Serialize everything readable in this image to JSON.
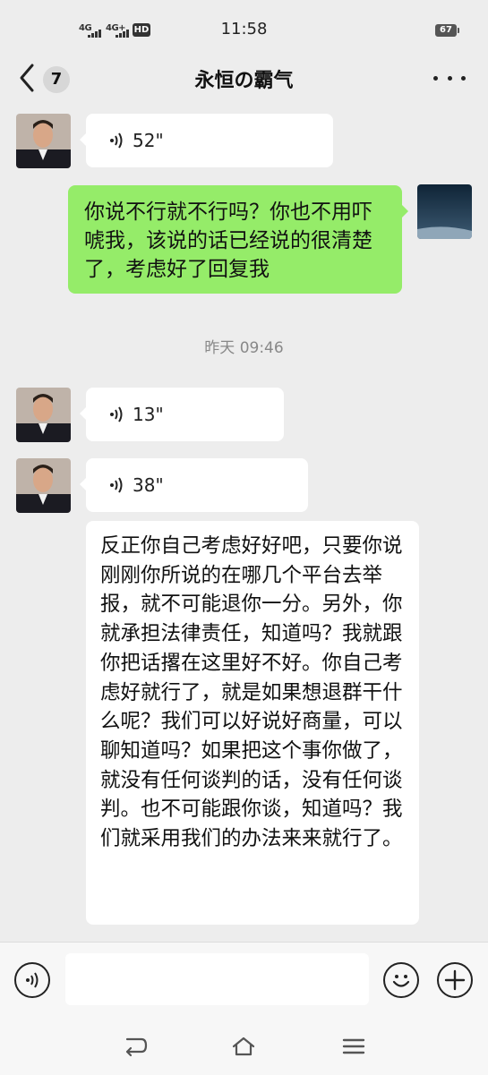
{
  "status_bar": {
    "net1": "4G",
    "net2": "4G+",
    "hd": "HD",
    "time": "11:58",
    "battery": "67"
  },
  "header": {
    "unread_count": "7",
    "title": "永恒の霸气"
  },
  "timestamp": "昨天 09:46",
  "messages": [
    {
      "duration": "52\""
    },
    {
      "text": "你说不行就不行吗？你也不用吓唬我，该说的话已经说的很清楚了，考虑好了回复我"
    },
    {
      "duration": "13\""
    },
    {
      "duration": "38\""
    },
    {
      "text": "反正你自己考虑好好吧，只要你说刚刚你所说的在哪几个平台去举报，就不可能退你一分。另外，你就承担法律责任，知道吗？我就跟你把话撂在这里好不好。你自己考虑好就行了，就是如果想退群干什么呢？我们可以好说好商量，可以聊知道吗？如果把这个事你做了，就没有任何谈判的话，没有任何谈判。也不可能跟你谈，知道吗？我们就采用我们的办法来来就行了。"
    }
  ],
  "colors": {
    "background": "#ededed",
    "sent_bubble": "#95ec69",
    "received_bubble": "#ffffff"
  },
  "icons": [
    "back-arrow-icon",
    "more-icon",
    "voice-mode-icon",
    "emoji-icon",
    "add-icon",
    "voice-wave-icon",
    "nav-back-icon",
    "nav-home-icon",
    "nav-menu-icon"
  ]
}
